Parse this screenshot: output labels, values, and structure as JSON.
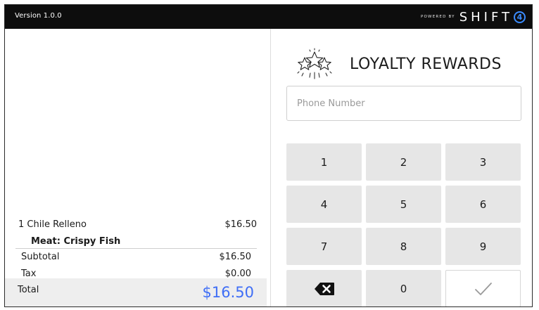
{
  "header": {
    "version": "Version 1.0.0",
    "powered_by": "POWERED BY",
    "brand": "SHIFT",
    "brand_mark": "4"
  },
  "order": {
    "items": [
      {
        "name": "1 Chile Relleno",
        "price": "$16.50",
        "modifier": "Meat: Crispy Fish"
      }
    ],
    "subtotal_label": "Subtotal",
    "subtotal_value": "$16.50",
    "tax_label": "Tax",
    "tax_value": "$0.00",
    "total_label": "Total",
    "total_value": "$16.50"
  },
  "loyalty": {
    "title": "LOYALTY REWARDS",
    "icon": "stars-icon",
    "phone_placeholder": "Phone Number",
    "phone_value": ""
  },
  "keypad": {
    "keys": [
      "1",
      "2",
      "3",
      "4",
      "5",
      "6",
      "7",
      "8",
      "9",
      "0"
    ],
    "backspace_icon": "backspace-icon",
    "confirm_icon": "checkmark-icon"
  },
  "colors": {
    "topbar": "#0d0d0d",
    "accent_blue": "#3f6ef6",
    "key_background": "#e6e6e6"
  }
}
